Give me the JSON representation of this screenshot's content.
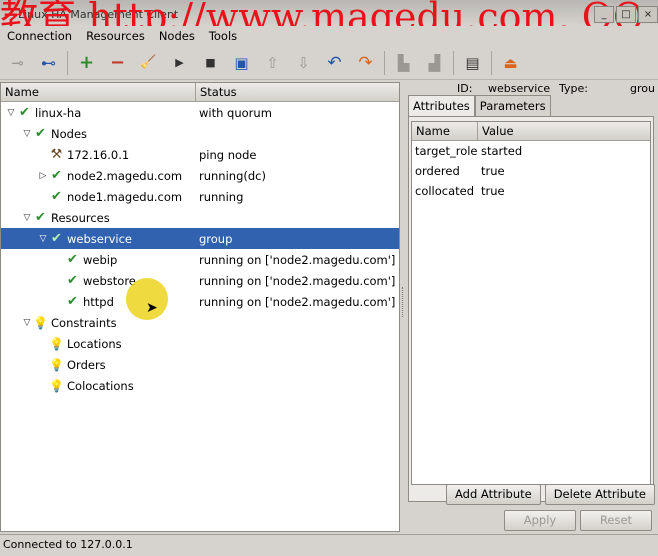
{
  "window": {
    "title": "Linux HA Management Client",
    "watermark": "教育 http://www.magedu.com, QQ",
    "controls": [
      "_",
      "□",
      "×"
    ]
  },
  "menu": [
    "Connection",
    "Resources",
    "Nodes",
    "Tools"
  ],
  "toolbar": [
    {
      "icon": "connect-plug-icon",
      "glyph": "⊸"
    },
    {
      "icon": "disconnect-plug-icon",
      "glyph": "⊷"
    },
    {
      "icon": "add-icon",
      "glyph": "+"
    },
    {
      "icon": "remove-icon",
      "glyph": "−"
    },
    {
      "icon": "cleanup-broom-icon",
      "glyph": "🧹"
    },
    {
      "icon": "start-icon",
      "glyph": "▶"
    },
    {
      "icon": "stop-icon",
      "glyph": "■"
    },
    {
      "icon": "default-settings-icon",
      "glyph": "▣"
    },
    {
      "icon": "move-up-icon",
      "glyph": "⇧"
    },
    {
      "icon": "move-down-icon",
      "glyph": "⇩"
    },
    {
      "icon": "undo-icon",
      "glyph": "↶"
    },
    {
      "icon": "redo-icon",
      "glyph": "↷"
    },
    {
      "icon": "standby-icon",
      "glyph": "▙"
    },
    {
      "icon": "active-icon",
      "glyph": "▟"
    },
    {
      "icon": "view-xml-icon",
      "glyph": "▤"
    },
    {
      "icon": "exit-icon",
      "glyph": "⏏"
    }
  ],
  "tree": {
    "columns": {
      "name": "Name",
      "status": "Status"
    },
    "rows": [
      {
        "depth": 0,
        "expander": "▽",
        "icon": "check",
        "name": "linux-ha",
        "status": "with quorum"
      },
      {
        "depth": 1,
        "expander": "▽",
        "icon": "check",
        "name": "Nodes",
        "status": ""
      },
      {
        "depth": 2,
        "expander": "",
        "icon": "tools",
        "name": "172.16.0.1",
        "status": "ping node"
      },
      {
        "depth": 2,
        "expander": "▷",
        "icon": "check",
        "name": "node2.magedu.com",
        "status": "running(dc)"
      },
      {
        "depth": 2,
        "expander": "",
        "icon": "check",
        "name": "node1.magedu.com",
        "status": "running"
      },
      {
        "depth": 1,
        "expander": "▽",
        "icon": "check",
        "name": "Resources",
        "status": ""
      },
      {
        "depth": 2,
        "expander": "▽",
        "icon": "check",
        "name": "webservice",
        "status": "group",
        "selected": true
      },
      {
        "depth": 3,
        "expander": "",
        "icon": "check",
        "name": "webip",
        "status": "running on ['node2.magedu.com']"
      },
      {
        "depth": 3,
        "expander": "",
        "icon": "check",
        "name": "webstore",
        "status": "running on ['node2.magedu.com']"
      },
      {
        "depth": 3,
        "expander": "",
        "icon": "check",
        "name": "httpd",
        "status": "running on ['node2.magedu.com']"
      },
      {
        "depth": 1,
        "expander": "▽",
        "icon": "bulb",
        "name": "Constraints",
        "status": ""
      },
      {
        "depth": 2,
        "expander": "",
        "icon": "bulb",
        "name": "Locations",
        "status": ""
      },
      {
        "depth": 2,
        "expander": "",
        "icon": "bulb",
        "name": "Orders",
        "status": ""
      },
      {
        "depth": 2,
        "expander": "",
        "icon": "bulb",
        "name": "Colocations",
        "status": ""
      }
    ]
  },
  "details": {
    "id_label": "ID:",
    "id_value": "webservice",
    "type_label": "Type:",
    "type_value": "grou",
    "tabs": [
      "Attributes",
      "Parameters"
    ],
    "active_tab": "Attributes",
    "columns": {
      "name": "Name",
      "value": "Value"
    },
    "attributes": [
      {
        "name": "target_role",
        "value": "started"
      },
      {
        "name": "ordered",
        "value": "true"
      },
      {
        "name": "collocated",
        "value": "true"
      }
    ],
    "add_label": "Add Attribute",
    "delete_label": "Delete Attribute",
    "apply_label": "Apply",
    "reset_label": "Reset"
  },
  "status_bar": "Connected to 127.0.0.1"
}
